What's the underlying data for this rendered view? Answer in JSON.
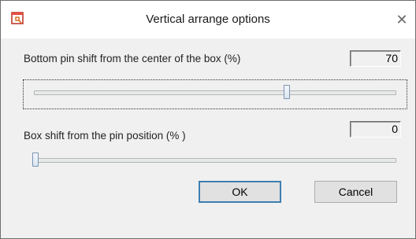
{
  "window": {
    "title": "Vertical arrange options",
    "close_glyph": "✕",
    "app_icon": "document-pin-icon"
  },
  "pin_shift": {
    "label": "Bottom pin shift from the center of the box (%)",
    "value": "70",
    "slider_fraction": 0.7
  },
  "box_shift": {
    "label": "Box shift from the pin position (% )",
    "value": "0",
    "slider_fraction": 0.0
  },
  "buttons": {
    "ok": "OK",
    "cancel": "Cancel"
  },
  "colors": {
    "accent": "#3c7fb1",
    "dialog_bg": "#f0f0f0"
  }
}
